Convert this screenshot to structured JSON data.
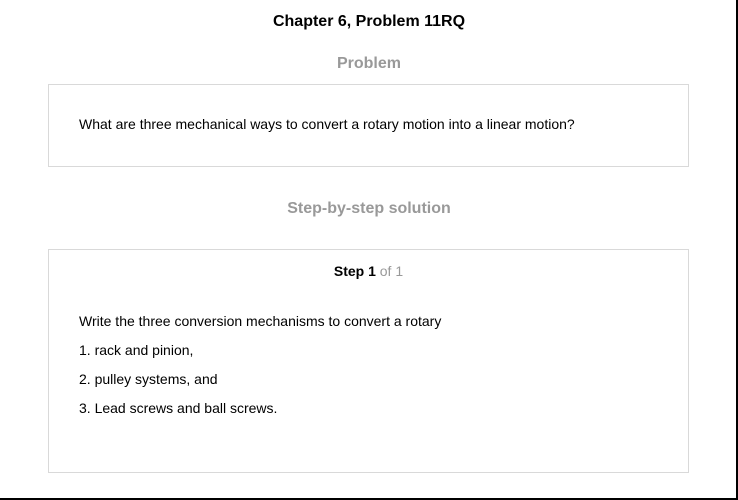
{
  "page": {
    "title": "Chapter 6, Problem 11RQ"
  },
  "problem": {
    "heading": "Problem",
    "text": "What are three mechanical ways to convert a rotary motion into a linear motion?"
  },
  "solution": {
    "heading": "Step-by-step solution",
    "step": {
      "label": "Step 1",
      "of_text": " of 1"
    },
    "lines": [
      "Write the three conversion mechanisms to convert a rotary",
      "1. rack and pinion,",
      "2. pulley systems, and",
      "3. Lead screws and ball screws."
    ]
  },
  "colors": {
    "heading_gray": "#999999",
    "box_border": "#d9d9d9",
    "text": "#000000"
  }
}
